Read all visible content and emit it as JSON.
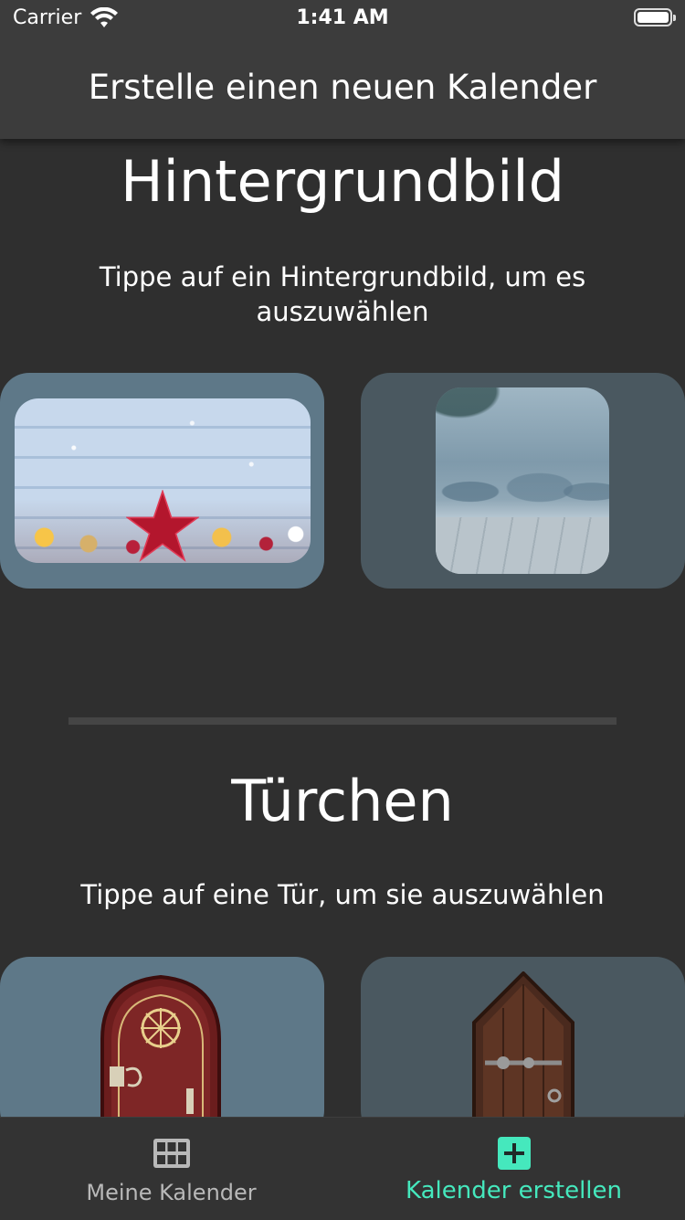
{
  "status_bar": {
    "carrier": "Carrier",
    "time": "1:41 AM"
  },
  "header": {
    "title": "Erstelle einen neuen Kalender"
  },
  "background_section": {
    "title": "Hintergrundbild",
    "subtitle": "Tippe auf ein Hintergrundbild, um es auszuwählen",
    "options": [
      {
        "name": "christmas-star-wood",
        "selected": true
      },
      {
        "name": "snowy-forest",
        "selected": false
      }
    ]
  },
  "door_section": {
    "title": "Türchen",
    "subtitle": "Tippe auf eine Tür, um sie auszuwählen",
    "options": [
      {
        "name": "red-wood-door",
        "selected": true
      },
      {
        "name": "dark-wood-door",
        "selected": false
      }
    ]
  },
  "tab_bar": {
    "tabs": [
      {
        "label": "Meine Kalender",
        "icon": "grid-icon",
        "active": false
      },
      {
        "label": "Kalender erstellen",
        "icon": "plus-square-icon",
        "active": true
      }
    ]
  },
  "colors": {
    "background": "#2f2f2f",
    "header": "#3c3c3c",
    "selected_card": "#5e7888",
    "unselected_card": "#4a5860",
    "accent": "#45e8bd"
  }
}
